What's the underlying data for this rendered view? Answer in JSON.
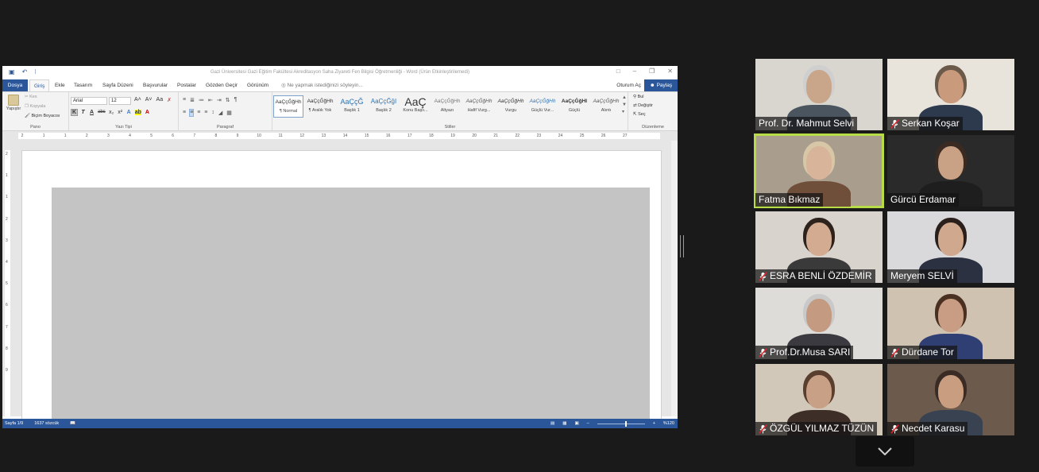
{
  "word": {
    "window_title": "Gazi Üniversitesi Gazi Eğitim Fakültesi Akreditasyon Saha Ziyareti Fen Bilgisi Öğretmenliği - Word (Ürün Etkinleştirilemedi)",
    "tabs": [
      "Dosya",
      "Giriş",
      "Ekle",
      "Tasarım",
      "Sayfa Düzeni",
      "Başvurular",
      "Postalar",
      "Gözden Geçir",
      "Görünüm"
    ],
    "active_tab": "Giriş",
    "tell_me": "Ne yapmak istediğinizi söyleyin...",
    "sign_in": "Oturum Aç",
    "share": "Paylaş",
    "clipboard": {
      "paste": "Yapıştır",
      "cut": "Kes",
      "copy": "Kopyala",
      "format_painter": "Biçim Boyacısı",
      "group": "Pano"
    },
    "font": {
      "name": "Arial",
      "size": "12",
      "group": "Yazı Tipi"
    },
    "paragraph": {
      "group": "Paragraf"
    },
    "styles": {
      "group": "Stiller",
      "items": [
        {
          "preview": "AaÇçĞğHh",
          "name": "¶ Normal"
        },
        {
          "preview": "AaÇçĞğHh",
          "name": "¶ Aralık Yok"
        },
        {
          "preview": "AaÇçĞ",
          "name": "Başlık 1"
        },
        {
          "preview": "AaÇçĞğI",
          "name": "Başlık 2"
        },
        {
          "preview": "AaÇ",
          "name": "Konu Başlı..."
        },
        {
          "preview": "AaÇçĞğHh",
          "name": "Altyazı"
        },
        {
          "preview": "AaÇçĞğHh",
          "name": "Hafif Vurg..."
        },
        {
          "preview": "AaÇçĞğHh",
          "name": "Vurgu"
        },
        {
          "preview": "AaÇçĞğHh",
          "name": "Güçlü Vur..."
        },
        {
          "preview": "AaÇçĞğHI",
          "name": "Güçlü"
        },
        {
          "preview": "AaÇçĞğHh",
          "name": "Alıntı"
        }
      ]
    },
    "editing": {
      "find": "Bul",
      "replace": "Değiştir",
      "select": "Seç",
      "group": "Düzenleme"
    },
    "ruler_numbers": [
      "2",
      "1",
      "1",
      "2",
      "3",
      "4",
      "5",
      "6",
      "7",
      "8",
      "9",
      "10",
      "11",
      "12",
      "13",
      "14",
      "15",
      "16",
      "17",
      "18",
      "19",
      "20",
      "21",
      "22",
      "23",
      "24",
      "25",
      "26",
      "27"
    ],
    "vruler_numbers": [
      "2",
      "1",
      "1",
      "2",
      "3",
      "4",
      "5",
      "6",
      "7",
      "8",
      "9"
    ],
    "status": {
      "page": "Sayfa 1/9",
      "words": "1637 sözcük",
      "zoom": "%120",
      "zoom_fraction": 0.58
    }
  },
  "participants": [
    {
      "name": "Prof. Dr. Mahmut Selvi",
      "muted": false,
      "speaking": false,
      "bg": "#d9d6cf",
      "skin": "#c9a58a",
      "hair": "#cfcfcf",
      "shirt": "#4a5560"
    },
    {
      "name": "Serkan Koşar",
      "muted": true,
      "speaking": false,
      "bg": "#e8e4dc",
      "skin": "#c99a7c",
      "hair": "#6b5a4a",
      "shirt": "#2d3a4e"
    },
    {
      "name": "Fatma Bıkmaz",
      "muted": false,
      "speaking": true,
      "bg": "#a99d8e",
      "skin": "#d8b49a",
      "hair": "#d8c7a6",
      "shirt": "#6f4e3a"
    },
    {
      "name": "Gürcü Erdamar",
      "muted": false,
      "speaking": false,
      "bg": "#2b2a2a",
      "skin": "#c9a185",
      "hair": "#3b2a22",
      "shirt": "#1e1e1e"
    },
    {
      "name": "ESRA BENLİ ÖZDEMİR",
      "muted": true,
      "speaking": false,
      "bg": "#d8d3cc",
      "skin": "#d3ab91",
      "hair": "#2e221c",
      "shirt": "#3b3a3a"
    },
    {
      "name": "Meryem SELVİ",
      "muted": false,
      "speaking": false,
      "bg": "#d9d9dc",
      "skin": "#d0a88e",
      "hair": "#2a1f1b",
      "shirt": "#2b3140"
    },
    {
      "name": "Prof.Dr.Musa SARI",
      "muted": true,
      "speaking": false,
      "bg": "#dedcd8",
      "skin": "#c49a80",
      "hair": "#c9c9c9",
      "shirt": "#3a3a40"
    },
    {
      "name": "Dürdane Tor",
      "muted": true,
      "speaking": false,
      "bg": "#cfc2b0",
      "skin": "#c99d83",
      "hair": "#4a3020",
      "shirt": "#2f3f74"
    },
    {
      "name": "ÖZGÜL YILMAZ TÜZÜN",
      "muted": true,
      "speaking": false,
      "bg": "#d2c8b9",
      "skin": "#c8a086",
      "hair": "#5a3e2e",
      "shirt": "#3d2e28"
    },
    {
      "name": "Necdet Karasu",
      "muted": true,
      "speaking": false,
      "bg": "#6c5a4c",
      "skin": "#c99d80",
      "hair": "#3a2c24",
      "shirt": "#394250"
    }
  ],
  "icons": {
    "collapse": "chevron-down-icon",
    "mute": "mic-muted-icon"
  }
}
